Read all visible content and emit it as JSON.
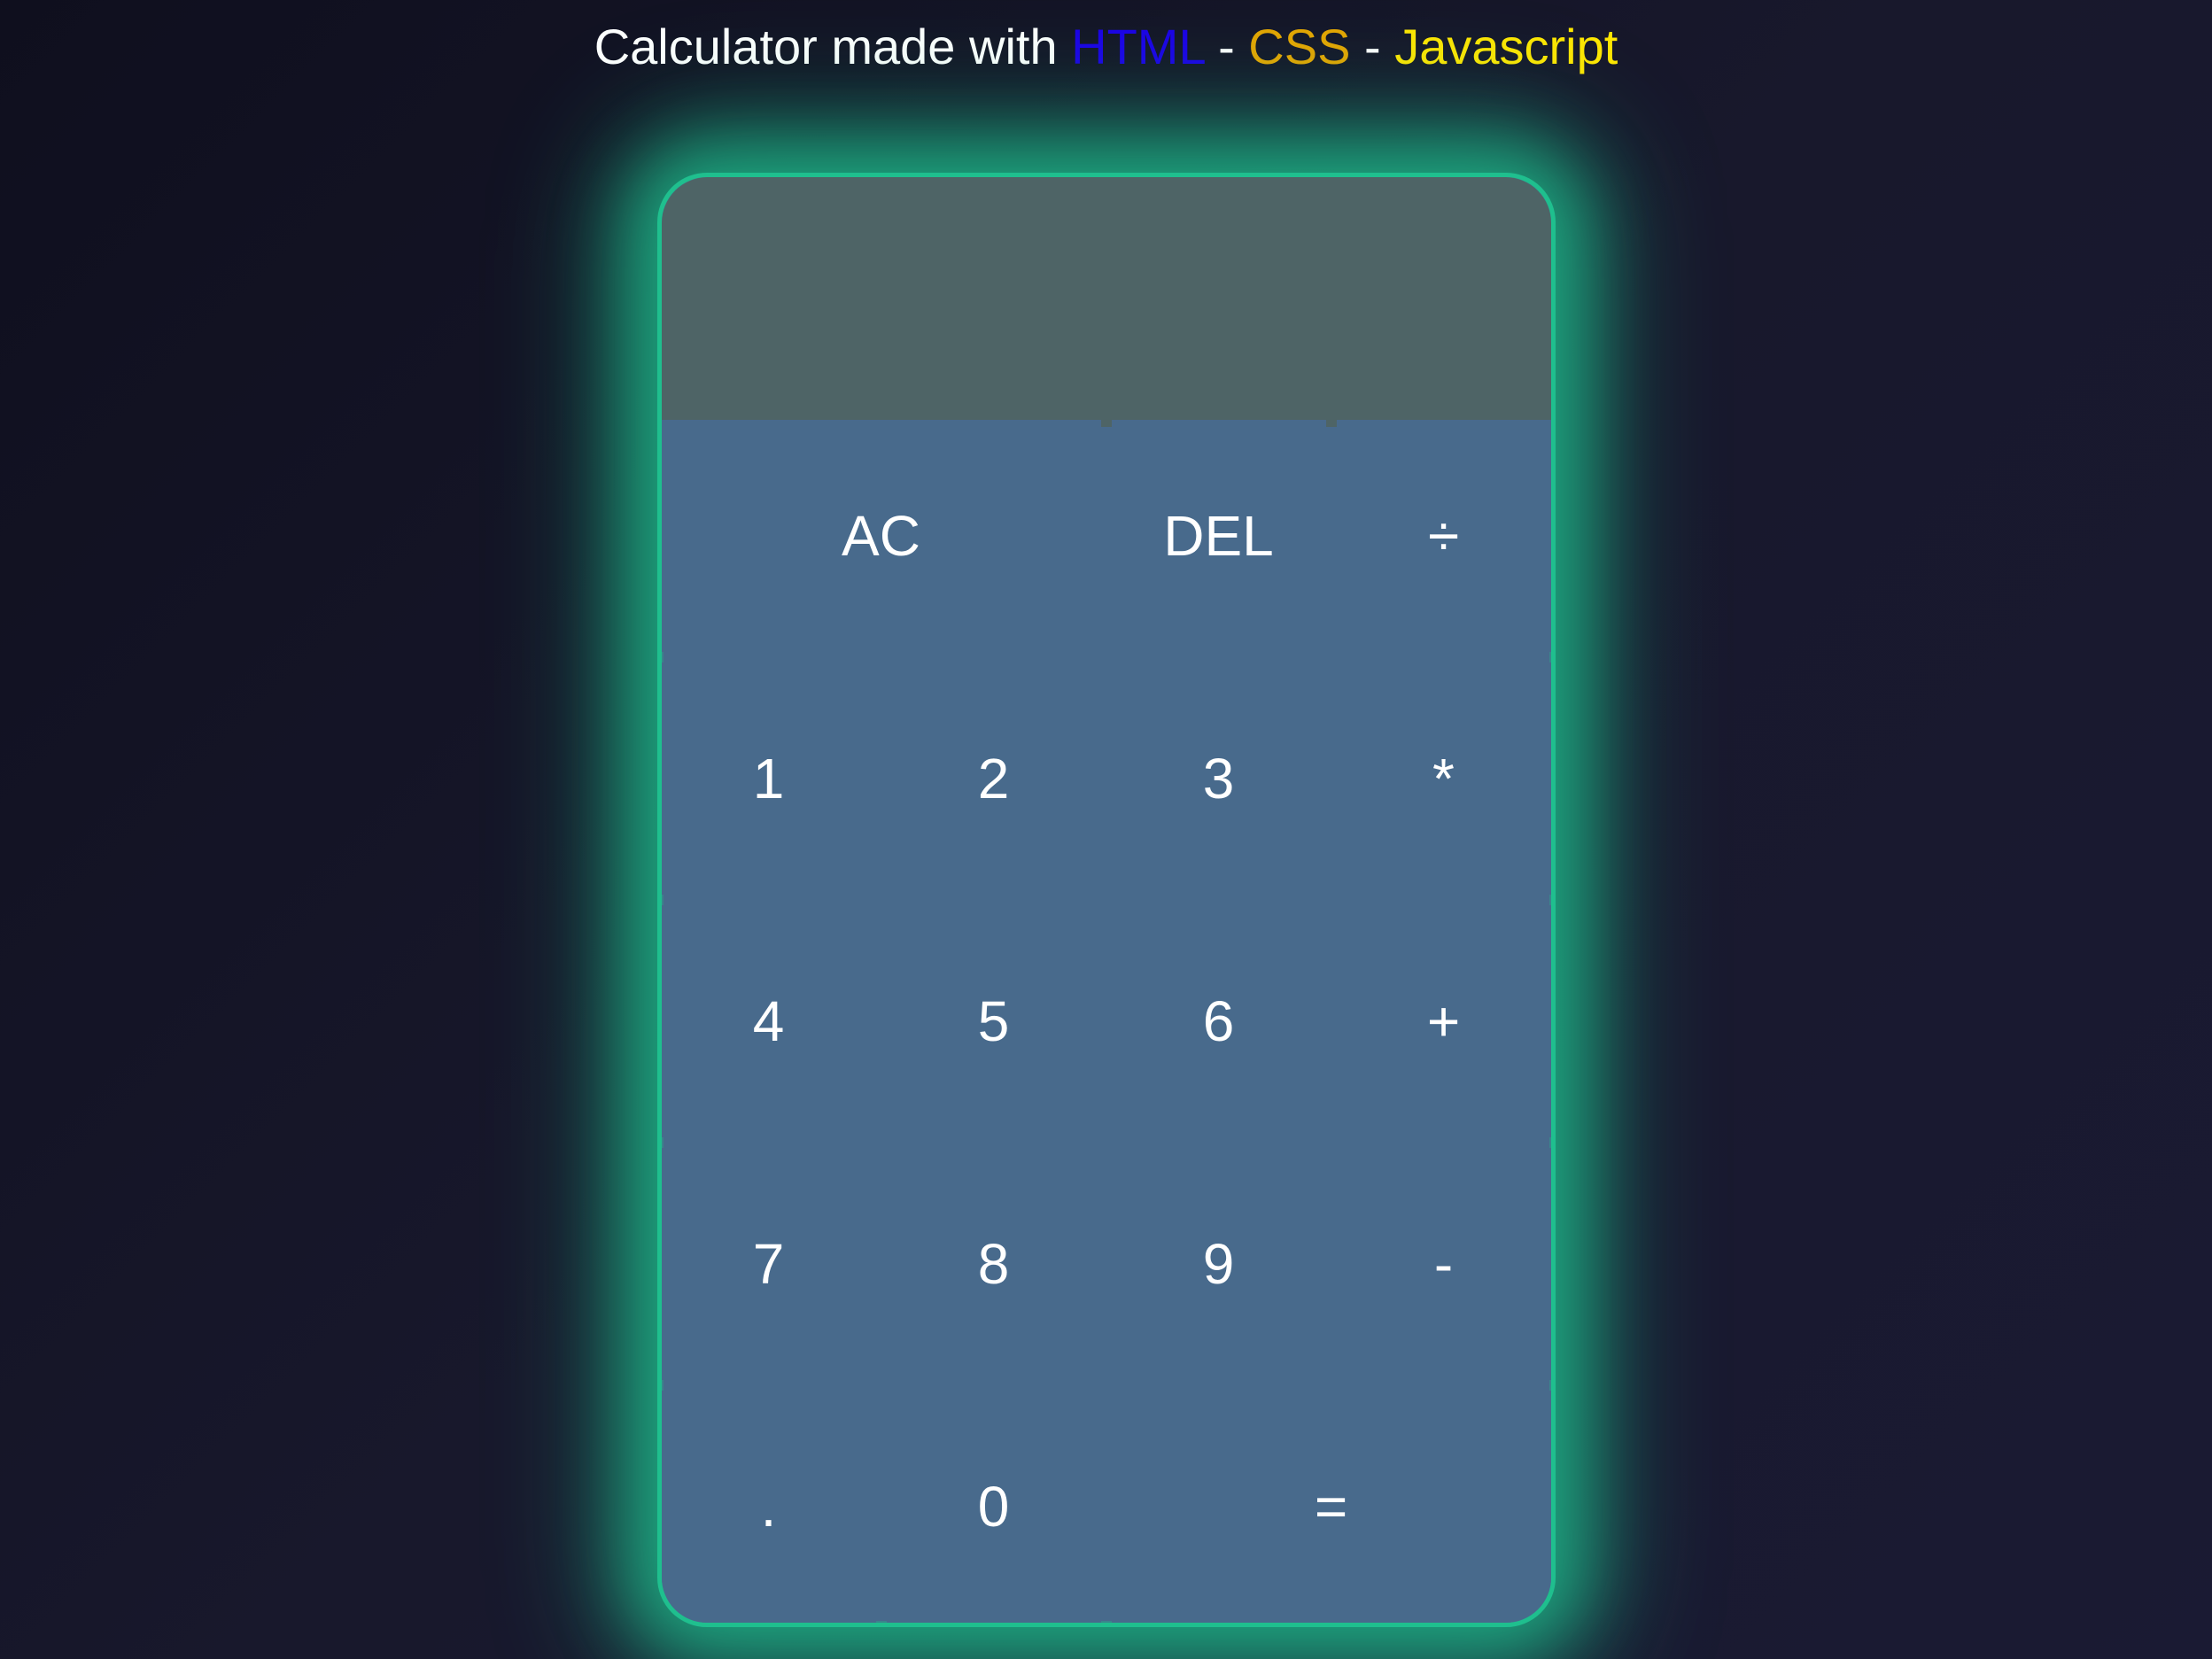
{
  "header": {
    "prefix": "Calculator made with ",
    "html": "HTML",
    "sep1": " - ",
    "css": "CSS",
    "sep2": " - ",
    "js": "Javascript"
  },
  "display": {
    "previous": "",
    "current": ""
  },
  "buttons": {
    "ac": "AC",
    "del": "DEL",
    "divide": "÷",
    "multiply": "*",
    "plus": "+",
    "minus": "-",
    "decimal": ".",
    "equals": "=",
    "n1": "1",
    "n2": "2",
    "n3": "3",
    "n4": "4",
    "n5": "5",
    "n6": "6",
    "n7": "7",
    "n8": "8",
    "n9": "9",
    "n0": "0"
  }
}
